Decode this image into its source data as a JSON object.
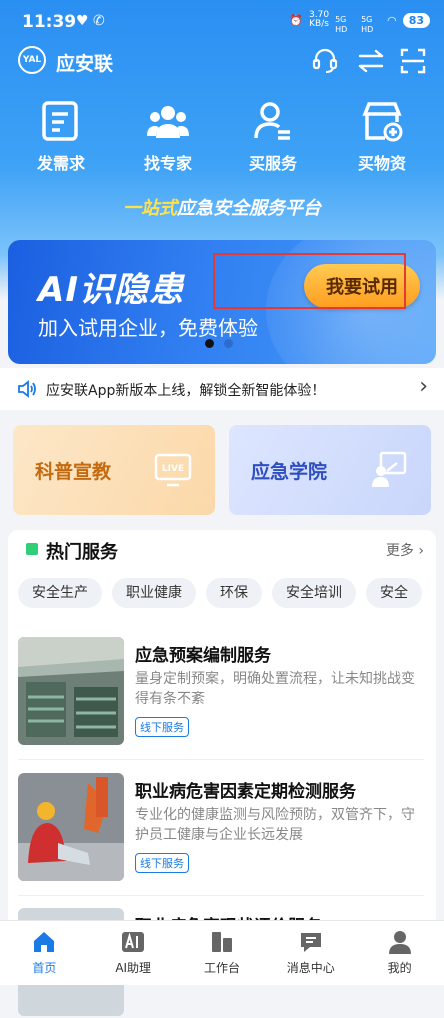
{
  "status": {
    "time": "11:39",
    "speed_value": "3.70",
    "speed_unit": "KB/s",
    "sig1": "5G HD",
    "sig2": "5G HD",
    "battery": "83"
  },
  "header": {
    "brand": "应安联",
    "logo_text": "YAL"
  },
  "quick_actions": [
    {
      "label": "发需求",
      "icon": "post-request-icon"
    },
    {
      "label": "找专家",
      "icon": "experts-icon"
    },
    {
      "label": "买服务",
      "icon": "buy-service-icon"
    },
    {
      "label": "买物资",
      "icon": "shop-supplies-icon"
    }
  ],
  "slogan": {
    "highlight": "一站式",
    "rest": "应急安全服务平台"
  },
  "banner": {
    "title": "AI识隐患",
    "subtitle": "加入试用企业，免费体验",
    "button": "我要试用"
  },
  "notice": {
    "text": "应安联App新版本上线，解锁全新智能体验！"
  },
  "cards": [
    {
      "label": "科普宣教",
      "badge": "LIVE"
    },
    {
      "label": "应急学院"
    }
  ],
  "hot_services": {
    "title": "热门服务",
    "more": "更多",
    "tags": [
      "安全生产",
      "职业健康",
      "环保",
      "安全培训",
      "安全"
    ],
    "items": [
      {
        "title": "应急预案编制服务",
        "desc": "量身定制预案，明确处置流程，让未知挑战变得有条不紊",
        "tag": "线下服务"
      },
      {
        "title": "职业病危害因素定期检测服务",
        "desc": "专业化的健康监测与风险预防，双管齐下，守护员工健康与企业长远发展",
        "tag": "线下服务"
      },
      {
        "title": "职业病危害现状评价服务"
      }
    ]
  },
  "tabbar": [
    {
      "label": "首页",
      "icon": "home-icon"
    },
    {
      "label": "AI助理",
      "icon": "ai-assistant-icon"
    },
    {
      "label": "工作台",
      "icon": "workbench-icon"
    },
    {
      "label": "消息中心",
      "icon": "message-icon"
    },
    {
      "label": "我的",
      "icon": "profile-icon"
    }
  ],
  "colors": {
    "primary": "#1a7be6",
    "accent": "#ff9d1f",
    "highlight": "#ffe14d",
    "green": "#2fcf7a"
  }
}
